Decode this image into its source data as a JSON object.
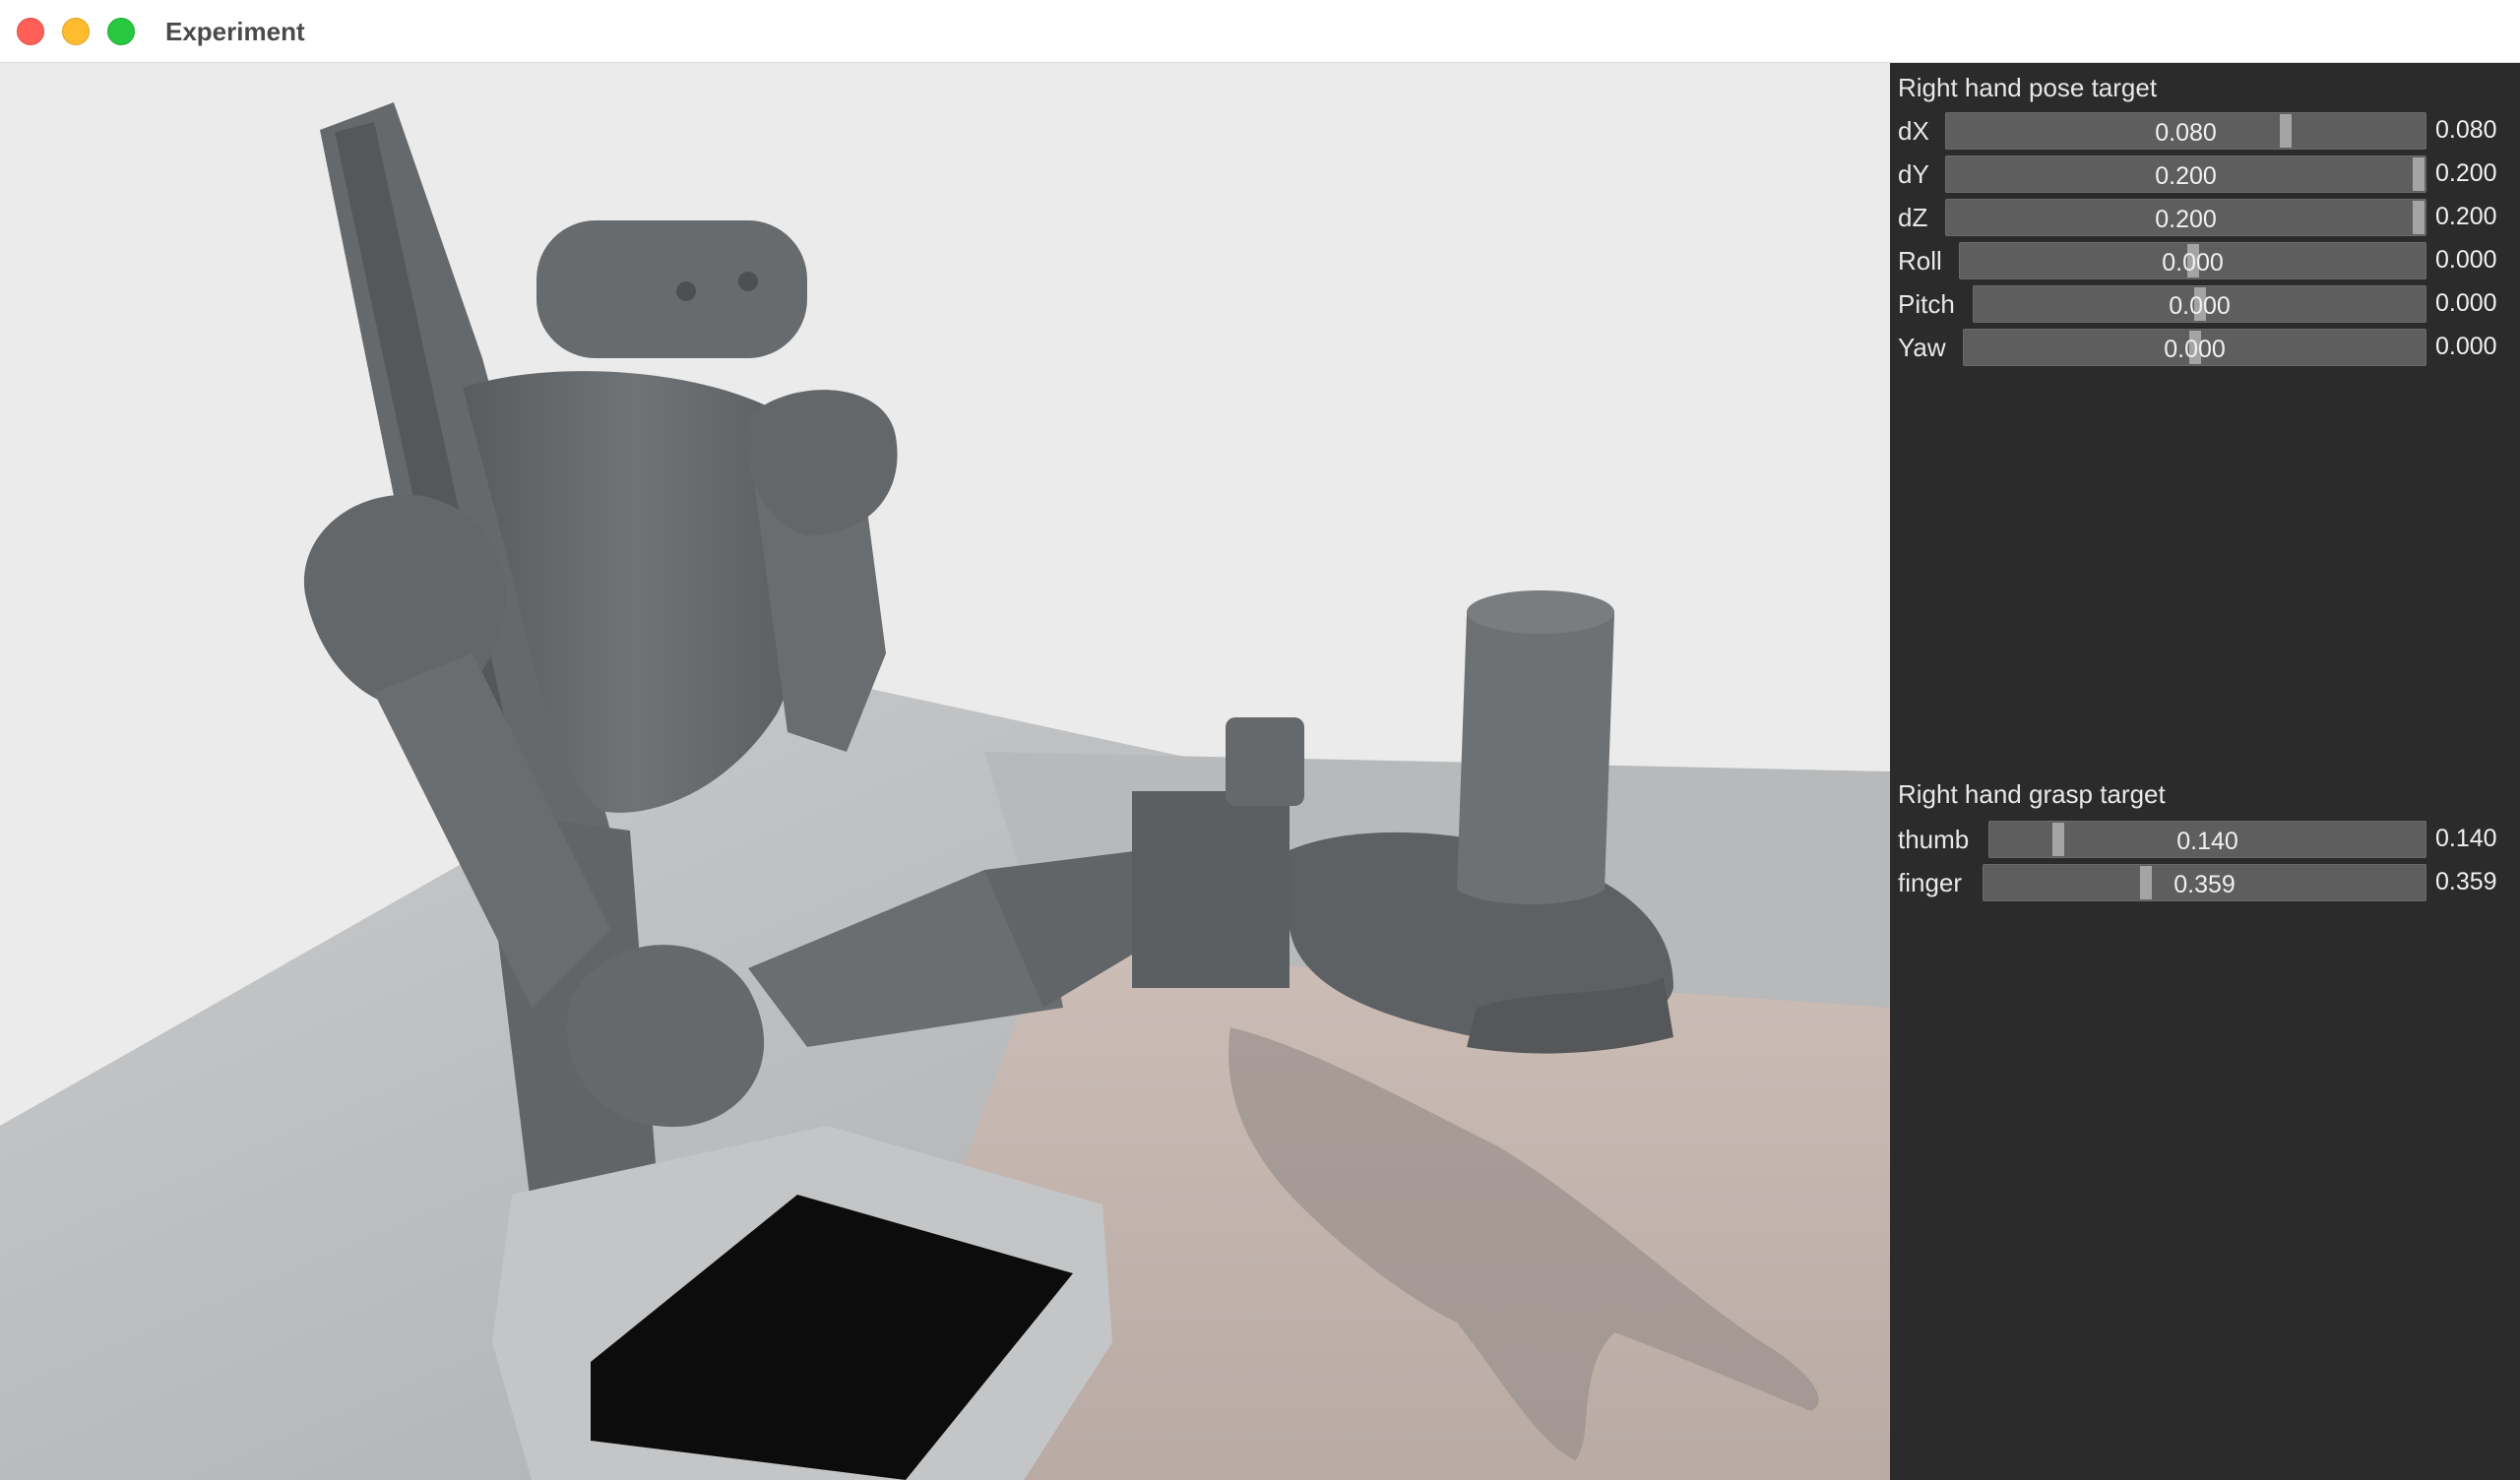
{
  "window": {
    "title": "Experiment"
  },
  "pose_section": {
    "title": "Right hand pose target",
    "sliders": [
      {
        "label": "dX",
        "value": "0.080",
        "readout": "0.080",
        "fraction": 0.7
      },
      {
        "label": "dY",
        "value": "0.200",
        "readout": "0.200",
        "fraction": 1.0
      },
      {
        "label": "dZ",
        "value": "0.200",
        "readout": "0.200",
        "fraction": 1.0
      },
      {
        "label": "Roll",
        "value": "0.000",
        "readout": "0.000",
        "fraction": 0.5
      },
      {
        "label": "Pitch",
        "value": "0.000",
        "readout": "0.000",
        "fraction": 0.5
      },
      {
        "label": "Yaw",
        "value": "0.000",
        "readout": "0.000",
        "fraction": 0.5
      }
    ]
  },
  "grasp_section": {
    "title": "Right hand grasp target",
    "sliders": [
      {
        "label": "thumb",
        "value": "0.140",
        "readout": "0.140",
        "fraction": 0.14
      },
      {
        "label": "finger",
        "value": "0.359",
        "readout": "0.359",
        "fraction": 0.359
      }
    ]
  },
  "colors": {
    "panel_bg": "#2b2b2b",
    "slider_track": "#5e5e5e",
    "slider_knob": "#a4a4a4",
    "robot_gray": "#6b6e70",
    "floor_gray": "#b9bbbd",
    "table_tint": "#c8bab3"
  }
}
